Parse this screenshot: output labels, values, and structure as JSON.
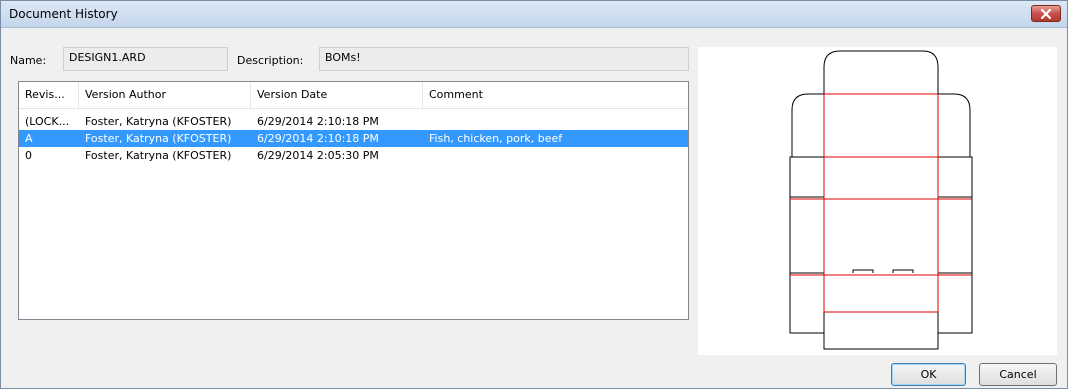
{
  "window": {
    "title": "Document History",
    "close_icon": "close-icon"
  },
  "fields": {
    "name_label": "Name:",
    "name_value": "DESIGN1.ARD",
    "description_label": "Description:",
    "description_value": "BOMs!"
  },
  "table": {
    "columns": [
      "Revis...",
      "Version Author",
      "Version Date",
      "Comment"
    ],
    "rows": [
      {
        "revision": "(LOCK...",
        "author": "Foster, Katryna (KFOSTER)",
        "date": "6/29/2014 2:10:18 PM",
        "comment": ""
      },
      {
        "revision": "A",
        "author": "Foster, Katryna (KFOSTER)",
        "date": "6/29/2014 2:10:18 PM",
        "comment": "Fish, chicken, pork, beef"
      },
      {
        "revision": "0",
        "author": "Foster, Katryna (KFOSTER)",
        "date": "6/29/2014 2:05:30 PM",
        "comment": ""
      }
    ],
    "selected_row": 1,
    "selection_color": "#3399ff"
  },
  "preview": {
    "cut_line_color": "#000000",
    "fold_line_color": "#e00000"
  },
  "buttons": {
    "ok_label": "OK",
    "cancel_label": "Cancel"
  }
}
